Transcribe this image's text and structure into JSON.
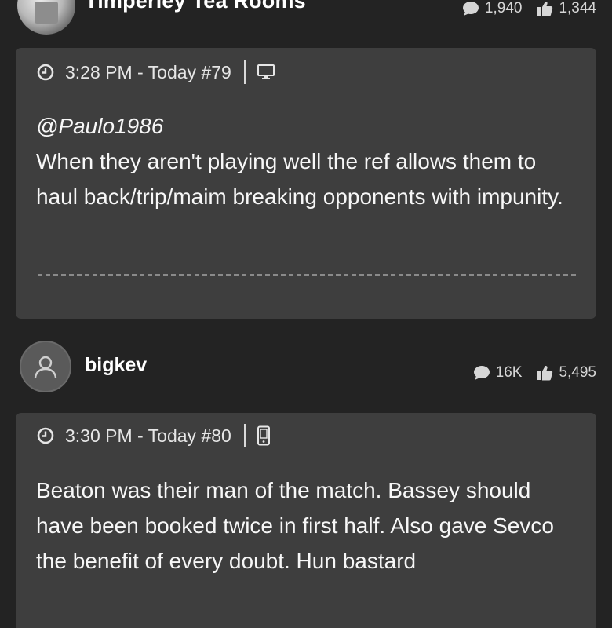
{
  "top_author": {
    "name": "Timperley Tea Rooms",
    "posts_count": "1,940",
    "likes_count": "1,344"
  },
  "posts": [
    {
      "time": "3:28 PM - Today",
      "number": "#79",
      "device_icon": "desktop-icon",
      "mention": "@Paulo1986",
      "body": "When they aren't playing well the ref allows them to haul back/trip/maim breaking opponents with impunity."
    },
    {
      "time": "3:30 PM - Today",
      "number": "#80",
      "device_icon": "mobile-icon",
      "body": "Beaton was their man of the match. Bassey should have been booked twice in first half. Also gave Sevco the benefit of every doubt. Hun bastard"
    }
  ],
  "author": {
    "name": "bigkev",
    "posts_count": "16K",
    "likes_count": "5,495"
  },
  "colors": {
    "background": "#232323",
    "card": "#3e3e3e",
    "text": "#f2f2f2"
  }
}
